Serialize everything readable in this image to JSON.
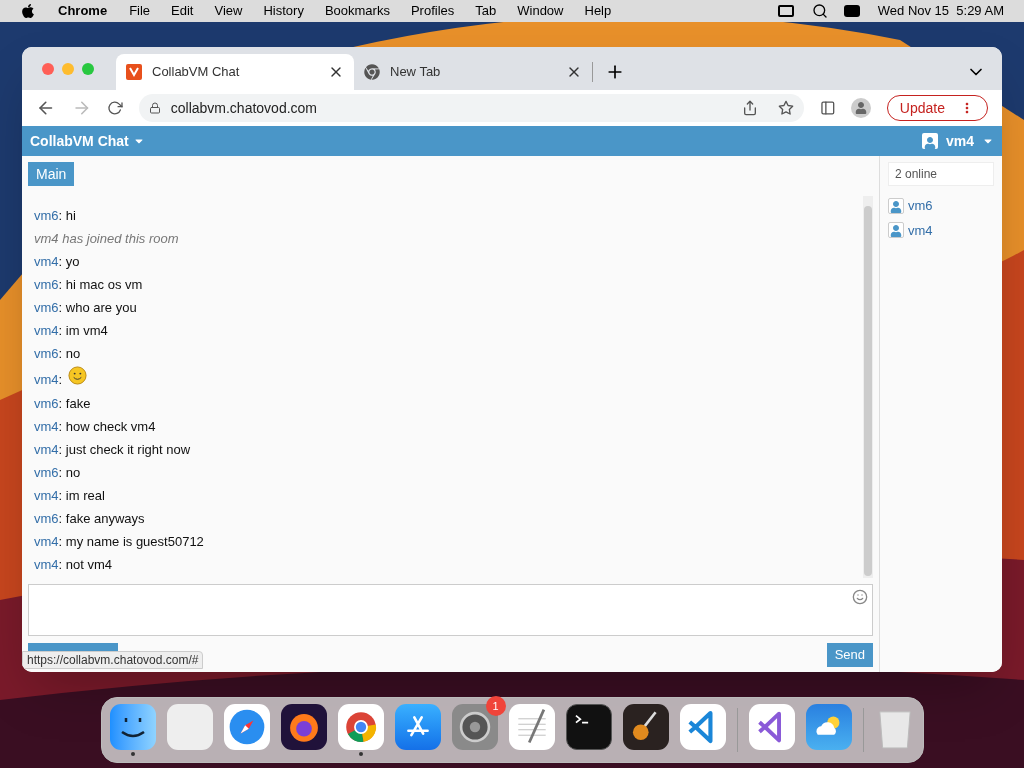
{
  "menu_bar": {
    "app": "Chrome",
    "items": [
      "File",
      "Edit",
      "View",
      "History",
      "Bookmarks",
      "Profiles",
      "Tab",
      "Window",
      "Help"
    ],
    "clock": "Wed Nov 15  5:29 AM"
  },
  "browser": {
    "tabs": [
      {
        "title": "CollabVM Chat",
        "selected": true,
        "kind": "collabvm"
      },
      {
        "title": "New Tab",
        "selected": false,
        "kind": "chrome"
      }
    ],
    "address": "collabvm.chatovod.com",
    "update_button": "Update",
    "status_url": "https://collabvm.chatovod.com/#"
  },
  "chat": {
    "title": "CollabVM Chat",
    "user": "vm4",
    "room_tab": {
      "label": "Main",
      "selected": true
    },
    "separator": ":",
    "messages": [
      {
        "kind": "message",
        "user": "vm6",
        "text": "hi"
      },
      {
        "kind": "system",
        "text": "vm4 has joined this room"
      },
      {
        "kind": "message",
        "user": "vm4",
        "text": "yo"
      },
      {
        "kind": "message",
        "user": "vm6",
        "text": "hi mac os vm"
      },
      {
        "kind": "message",
        "user": "vm6",
        "text": "who are you"
      },
      {
        "kind": "message",
        "user": "vm4",
        "text": "im vm4"
      },
      {
        "kind": "message",
        "user": "vm6",
        "text": "no"
      },
      {
        "kind": "emoji",
        "user": "vm4"
      },
      {
        "kind": "message",
        "user": "vm6",
        "text": "fake"
      },
      {
        "kind": "message",
        "user": "vm4",
        "text": "how check vm4"
      },
      {
        "kind": "message",
        "user": "vm4",
        "text": "just check it right now"
      },
      {
        "kind": "message",
        "user": "vm6",
        "text": "no"
      },
      {
        "kind": "message",
        "user": "vm4",
        "text": "im real"
      },
      {
        "kind": "message",
        "user": "vm6",
        "text": "fake anyways"
      },
      {
        "kind": "message",
        "user": "vm4",
        "text": "my name is guest50712"
      },
      {
        "kind": "message",
        "user": "vm4",
        "text": "not vm4"
      }
    ],
    "send_button": "Send",
    "online_count": "2 online",
    "users": [
      "vm6",
      "vm4"
    ]
  },
  "dock": {
    "apps": [
      {
        "kind": "finder",
        "running": true
      },
      {
        "kind": "launchpad",
        "running": false
      },
      {
        "kind": "safari",
        "running": false
      },
      {
        "kind": "firefox",
        "running": false
      },
      {
        "kind": "chrome",
        "running": true
      },
      {
        "kind": "appstore",
        "running": false
      },
      {
        "kind": "settings",
        "running": false,
        "badge": "1"
      },
      {
        "kind": "textedit",
        "running": false
      },
      {
        "kind": "terminal",
        "running": false
      },
      {
        "kind": "garageband",
        "running": false
      },
      {
        "kind": "vscode",
        "running": false
      },
      {
        "kind": "separator"
      },
      {
        "kind": "visualstudio",
        "running": false
      },
      {
        "kind": "weather",
        "running": false
      },
      {
        "kind": "separator"
      },
      {
        "kind": "trash",
        "running": false
      }
    ]
  }
}
